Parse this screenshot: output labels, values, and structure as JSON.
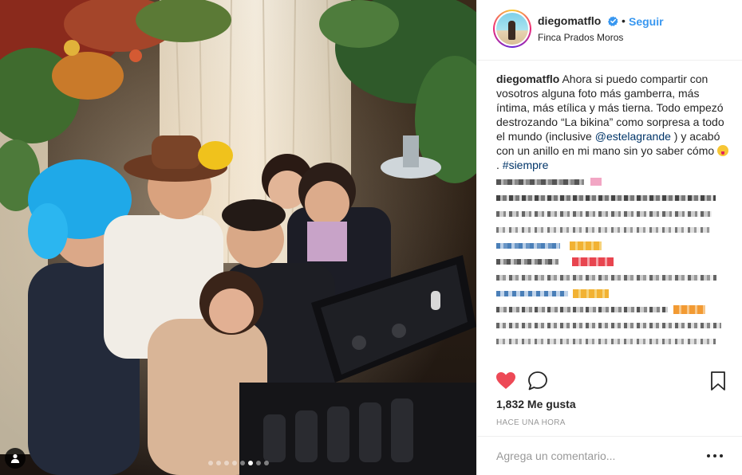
{
  "post": {
    "username": "diegomatflo",
    "follow_label": "Seguir",
    "separator": "•",
    "location": "Finca Prados Moros",
    "caption": {
      "user": "diegomatflo",
      "part1": "Ahora si puedo compartir con vosotros alguna foto más gamberra, más íntima, más etílica y más tierna. Todo empezó destrozando “La bikina” como sorpresa a todo el mundo (inclusive ",
      "mention": "@estelagrande",
      "part2": " ) y acabó con un anillo en mi mano sin yo saber cómo ",
      "part3": ". ",
      "hashtag": "#siempre"
    },
    "likes": "1,832 Me gusta",
    "time": "HACE UNA HORA",
    "comment_placeholder": "Agrega un comentario...",
    "carousel": {
      "count": 8,
      "active_index": 5
    }
  },
  "icons": {
    "verified": "verified-badge-icon",
    "heart": "heart-filled-icon",
    "comment": "comment-bubble-icon",
    "bookmark": "bookmark-icon",
    "user_tag": "user-tag-icon",
    "more": "more-options-icon"
  },
  "colors": {
    "link_blue": "#3897f0",
    "mention_navy": "#003569",
    "like_red": "#ed4956",
    "text": "#262626",
    "muted": "#999999"
  }
}
